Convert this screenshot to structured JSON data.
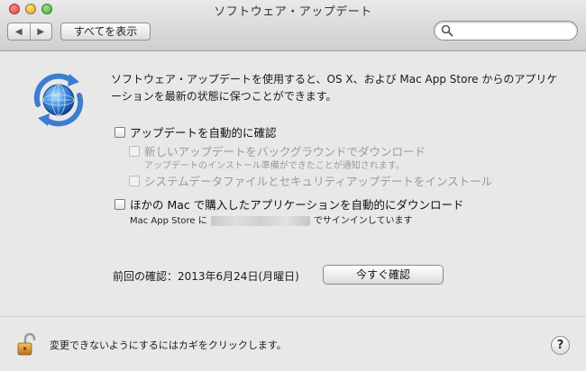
{
  "window": {
    "title": "ソフトウェア・アップデート"
  },
  "toolbar": {
    "back_glyph": "◀",
    "forward_glyph": "▶",
    "show_all_label": "すべてを表示",
    "search": {
      "value": "",
      "placeholder": ""
    }
  },
  "main": {
    "app_icon": "software-update-icon",
    "description": "ソフトウェア・アップデートを使用すると、OS X、および Mac App Store からのアプリケーションを最新の状態に保つことができます。",
    "options": [
      {
        "label": "アップデートを自動的に確認",
        "checked": false,
        "enabled": true
      },
      {
        "label": "新しいアップデートをバックグラウンドでダウンロード",
        "checked": false,
        "enabled": false,
        "note": "アップデートのインストール準備ができたことが通知されます。"
      },
      {
        "label": "システムデータファイルとセキュリティアップデートをインストール",
        "checked": false,
        "enabled": false
      },
      {
        "label": "ほかの Mac で購入したアプリケーションを自動的にダウンロード",
        "checked": false,
        "enabled": true
      }
    ],
    "signin_prefix": "Mac App Store に",
    "signin_suffix": "でサインインしています",
    "last_check": "前回の確認：2013年6月24日(月曜日)",
    "check_now_label": "今すぐ確認"
  },
  "footer": {
    "lock_text": "変更できないようにするにはカギをクリックします。",
    "help_label": "?"
  },
  "colors": {
    "traffic_close": "#e0443e",
    "traffic_minimize": "#dea123",
    "traffic_zoom": "#3cae34",
    "window_bg": "#e8e8e8"
  }
}
